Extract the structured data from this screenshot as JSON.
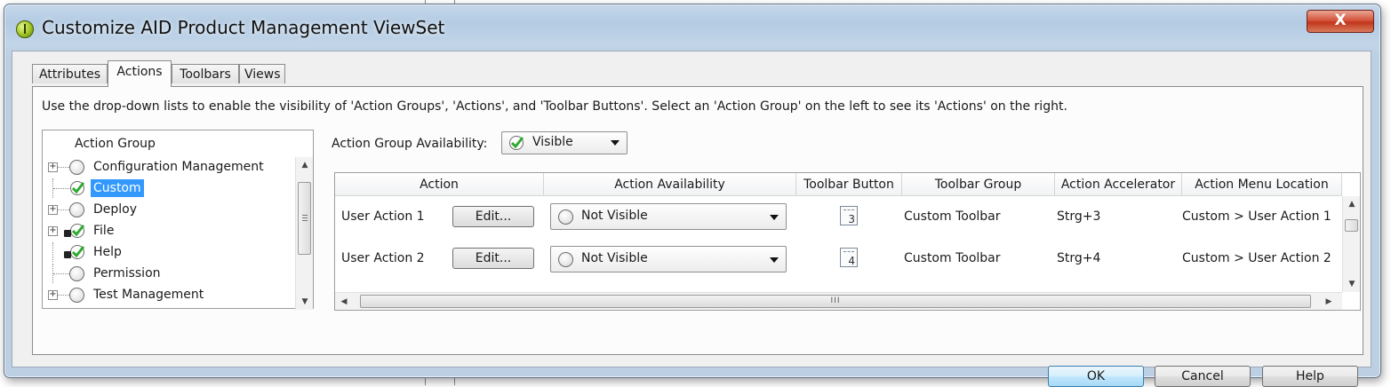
{
  "window": {
    "title": "Customize AID Product Management ViewSet",
    "close_glyph": "X"
  },
  "tabs": [
    {
      "label": "Attributes",
      "active": false
    },
    {
      "label": "Actions",
      "active": true
    },
    {
      "label": "Toolbars",
      "active": false
    },
    {
      "label": "Views",
      "active": false
    }
  ],
  "instructions": "Use the drop-down lists to enable the visibility of 'Action Groups', 'Actions', and 'Toolbar Buttons'.  Select an 'Action Group' on the left to see its 'Actions' on the right.",
  "tree": {
    "header": "Action Group",
    "items": [
      {
        "label": "Configuration Management",
        "expandable": true,
        "state": "radio",
        "locked": false,
        "selected": false
      },
      {
        "label": "Custom",
        "expandable": false,
        "state": "check",
        "locked": false,
        "selected": true
      },
      {
        "label": "Deploy",
        "expandable": true,
        "state": "radio",
        "locked": false,
        "selected": false
      },
      {
        "label": "File",
        "expandable": true,
        "state": "check",
        "locked": true,
        "selected": false
      },
      {
        "label": "Help",
        "expandable": false,
        "state": "check",
        "locked": true,
        "selected": false
      },
      {
        "label": "Permission",
        "expandable": false,
        "state": "radio",
        "locked": false,
        "selected": false
      },
      {
        "label": "Test Management",
        "expandable": true,
        "state": "radio",
        "locked": false,
        "selected": false
      }
    ]
  },
  "group_availability": {
    "label": "Action Group Availability:",
    "value": "Visible"
  },
  "table": {
    "headers": [
      "Action",
      "Action Availability",
      "Toolbar Button",
      "Toolbar Group",
      "Action Accelerator",
      "Action Menu Location"
    ],
    "edit_label": "Edit...",
    "scroll_grip": "III",
    "rows": [
      {
        "action": "User Action 1",
        "availability": "Not Visible",
        "button_number": "3",
        "toolbar_group": "Custom Toolbar",
        "accelerator": "Strg+3",
        "menu_location": "Custom > User Action 1"
      },
      {
        "action": "User Action 2",
        "availability": "Not Visible",
        "button_number": "4",
        "toolbar_group": "Custom Toolbar",
        "accelerator": "Strg+4",
        "menu_location": "Custom > User Action 2"
      }
    ]
  },
  "buttons": {
    "ok": "OK",
    "cancel": "Cancel",
    "help": "Help"
  },
  "colors": {
    "accent_selection": "#3399ff",
    "check_green": "#2faa2f"
  }
}
